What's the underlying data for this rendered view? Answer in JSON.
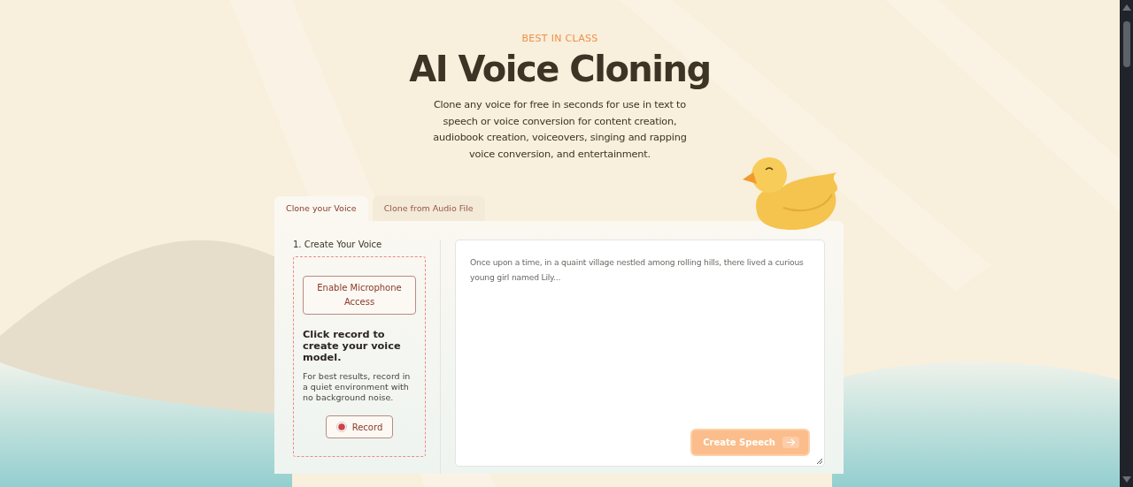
{
  "hero": {
    "eyebrow": "BEST IN CLASS",
    "title": "AI Voice Cloning",
    "description": "Clone any voice for free in seconds for use in text to speech or voice conversion for content creation, audiobook creation, voiceovers, singing and rapping voice conversion, and entertainment."
  },
  "tabs": [
    {
      "label": "Clone your Voice",
      "selected": true
    },
    {
      "label": "Clone from Audio File",
      "selected": false
    }
  ],
  "create_voice": {
    "heading": "1. Create Your Voice",
    "mic_button": "Enable Microphone Access",
    "prompt": "Click record to create your voice model.",
    "hint": "For best results, record in a quiet environment with no background noise.",
    "record_button": "Record"
  },
  "speech": {
    "placeholder": "Once upon a time, in a quaint village nestled among rolling hills, there lived a curious young girl named Lily...",
    "button": "Create Speech",
    "disabled": true
  }
}
